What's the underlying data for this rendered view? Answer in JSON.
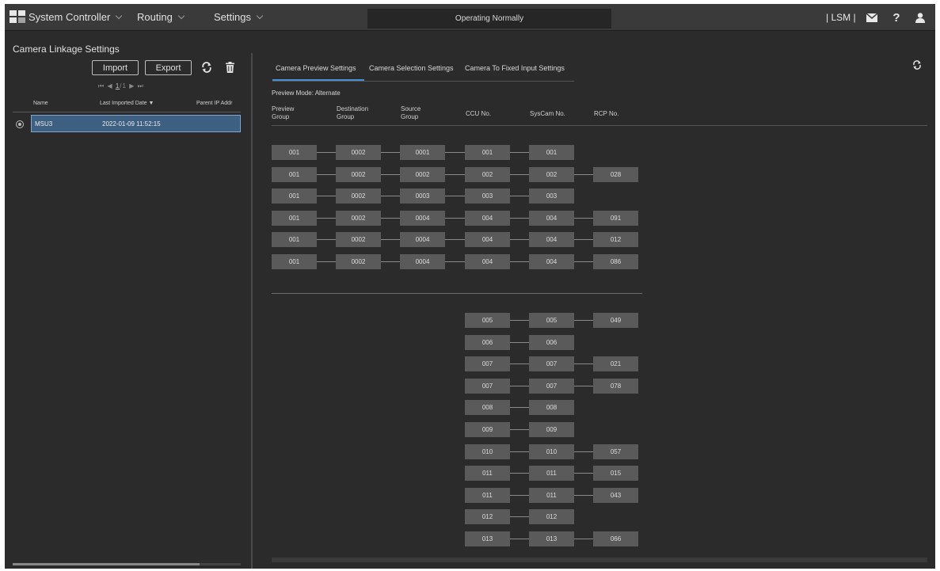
{
  "topbar": {
    "menus": [
      {
        "label": "System Controller"
      },
      {
        "label": "Routing"
      },
      {
        "label": "Settings"
      }
    ],
    "status": "Operating Normally",
    "lsm_label": "| LSM |",
    "help_label": "?"
  },
  "left": {
    "title": "Camera Linkage Settings",
    "import_label": "Import",
    "export_label": "Export",
    "pager": {
      "first": "⏮",
      "prev": "◀",
      "page": "1",
      "sep": "/",
      "total": "1",
      "next": "▶",
      "last": "⏭"
    },
    "columns": [
      "Name",
      "Last Imported Date ▼",
      "Parent IP Addr"
    ],
    "rows": [
      {
        "name": "MSU3",
        "date": "2022-01-09 11:52:15",
        "ip": ""
      }
    ]
  },
  "right": {
    "tabs": [
      "Camera Preview Settings",
      "Camera Selection Settings",
      "Camera To Fixed Input Settings"
    ],
    "active_tab": 0,
    "preview_mode_label": "Preview Mode:",
    "preview_mode_value": "Alternate",
    "columns": [
      "Preview\nGroup",
      "Destination\nGroup",
      "Source\nGroup",
      "CCU No.",
      "SysCam No.",
      "RCP No."
    ],
    "group_rows": [
      {
        "preview": "001",
        "dest": "0002",
        "source": "0001",
        "ccu": "001",
        "syscam": "001",
        "rcp": ""
      },
      {
        "preview": "001",
        "dest": "0002",
        "source": "0002",
        "ccu": "002",
        "syscam": "002",
        "rcp": "028"
      },
      {
        "preview": "001",
        "dest": "0002",
        "source": "0003",
        "ccu": "003",
        "syscam": "003",
        "rcp": ""
      },
      {
        "preview": "001",
        "dest": "0002",
        "source": "0004",
        "ccu": "004",
        "syscam": "004",
        "rcp": "091"
      },
      {
        "preview": "001",
        "dest": "0002",
        "source": "0004",
        "ccu": "004",
        "syscam": "004",
        "rcp": "012"
      },
      {
        "preview": "001",
        "dest": "0002",
        "source": "0004",
        "ccu": "004",
        "syscam": "004",
        "rcp": "086"
      }
    ],
    "ccu_rows": [
      {
        "ccu": "005",
        "syscam": "005",
        "rcp": "049"
      },
      {
        "ccu": "006",
        "syscam": "006",
        "rcp": ""
      },
      {
        "ccu": "007",
        "syscam": "007",
        "rcp": "021"
      },
      {
        "ccu": "007",
        "syscam": "007",
        "rcp": "078"
      },
      {
        "ccu": "008",
        "syscam": "008",
        "rcp": ""
      },
      {
        "ccu": "009",
        "syscam": "009",
        "rcp": ""
      },
      {
        "ccu": "010",
        "syscam": "010",
        "rcp": "057"
      },
      {
        "ccu": "011",
        "syscam": "011",
        "rcp": "015"
      },
      {
        "ccu": "011",
        "syscam": "011",
        "rcp": "043"
      },
      {
        "ccu": "012",
        "syscam": "012",
        "rcp": ""
      },
      {
        "ccu": "013",
        "syscam": "013",
        "rcp": "066"
      }
    ]
  },
  "icons": {
    "refresh": "refresh-icon",
    "trash": "trash-icon",
    "mail": "mail-icon",
    "help": "help-icon",
    "user": "user-icon",
    "radio": "radio-icon"
  },
  "colors": {
    "background": "#2b2b2b",
    "topbar": "#3a3a3a",
    "selected_row": "#3d5f82",
    "tab_accent": "#4a8fd4",
    "cell": "#5a5a5a"
  }
}
